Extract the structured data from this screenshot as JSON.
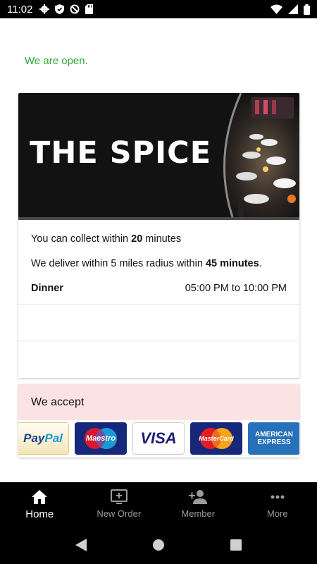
{
  "status_bar": {
    "time": "11:02"
  },
  "open_status": "We are open.",
  "restaurant": {
    "banner_title": "THE SPICE",
    "collect_prefix": "You can collect within ",
    "collect_value": "20",
    "collect_suffix": " minutes",
    "deliver_prefix": "We deliver within 5 miles radius within ",
    "deliver_value": "45 minutes",
    "deliver_suffix": ".",
    "hours": [
      {
        "label": "Dinner",
        "time": "05:00 PM to 10:00 PM"
      }
    ]
  },
  "payment": {
    "header": "We accept",
    "cards": [
      {
        "name": "paypal",
        "text_a": "Pay",
        "text_b": "Pal"
      },
      {
        "name": "maestro",
        "text": "Maestro"
      },
      {
        "name": "visa",
        "text": "VISA"
      },
      {
        "name": "mastercard",
        "text": "MasterCard"
      },
      {
        "name": "amex",
        "text": "AMERICAN EXPRESS"
      }
    ]
  },
  "bottom_nav": {
    "home": "Home",
    "new_order": "New Order",
    "member": "Member",
    "more": "More"
  },
  "colors": {
    "open_green": "#2ea836",
    "accept_bg": "#fbe3e3",
    "nav_bg": "#000000"
  }
}
